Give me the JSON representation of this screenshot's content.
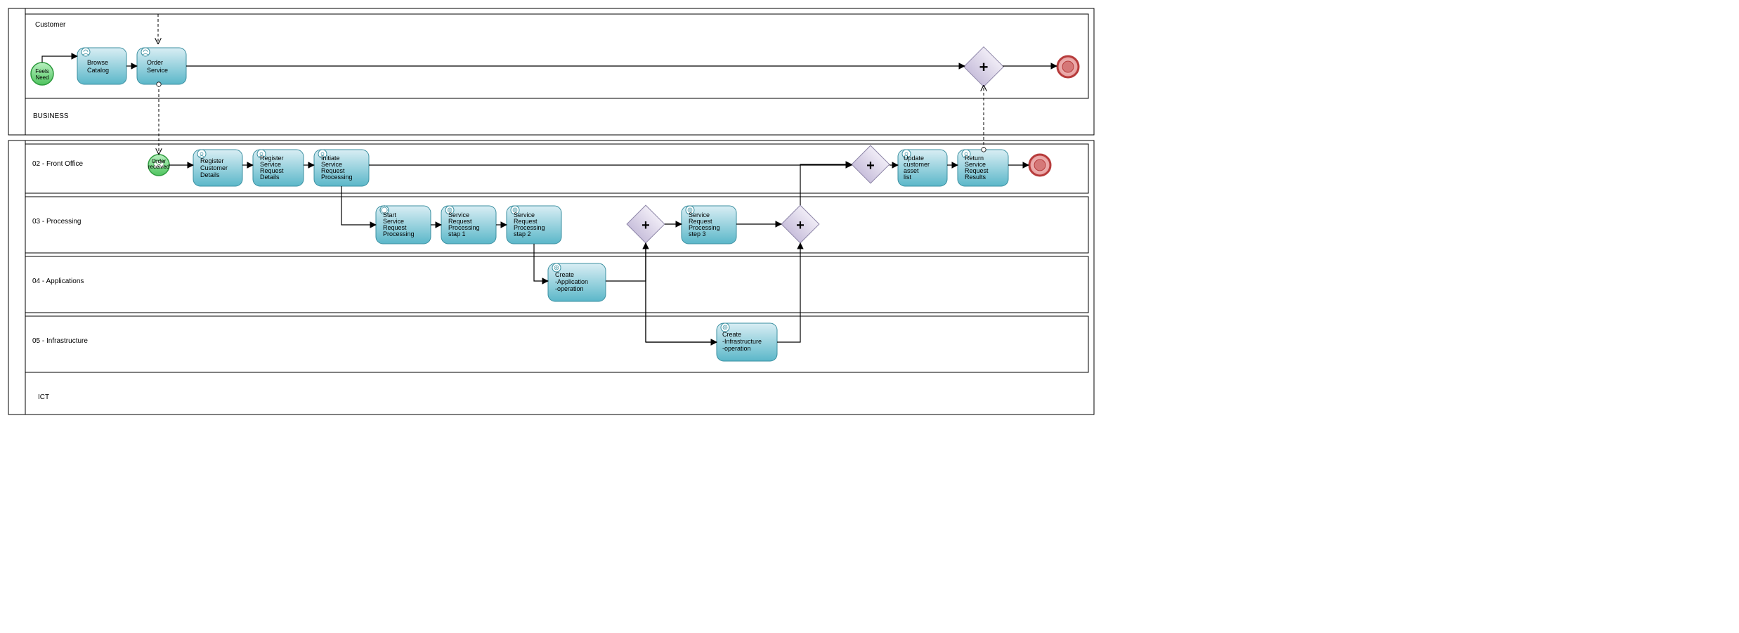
{
  "pools": {
    "business": {
      "label": "BUSINESS"
    },
    "ict": {
      "label": "ICT"
    }
  },
  "lanes": {
    "customer": {
      "label": "Customer"
    },
    "front_office": {
      "label": "02 - Front Office"
    },
    "processing": {
      "label": "03 - Processing"
    },
    "applications": {
      "label": "04 - Applications"
    },
    "infrastructure": {
      "label": "05 - Infrastructure"
    }
  },
  "events": {
    "feels_need": {
      "label": "Feels Need"
    },
    "order_received": {
      "label": "Order received"
    }
  },
  "tasks": {
    "browse_catalog": {
      "label": "Browse Catalog"
    },
    "order_service": {
      "label": "Order Service"
    },
    "register_customer_details": {
      "label": "Register Customer Details"
    },
    "register_service_request_details": {
      "label": "Register Service Request Details"
    },
    "initiate_service_request_processing": {
      "label": "Initiate Service Request Processing"
    },
    "update_customer_asset_list": {
      "label": "Update customer asset list"
    },
    "return_service_request_results": {
      "label": "Return Service Request Results"
    },
    "start_service_request_processing": {
      "label": "Start Service Request Processing"
    },
    "service_request_processing_step1": {
      "label": "Service Request Processing stap 1"
    },
    "service_request_processing_step2": {
      "label": "Service Request Processing stap 2"
    },
    "service_request_processing_step3": {
      "label": "Service Request Processing step 3"
    },
    "create_application_operation": {
      "label": "Create -Application -operation"
    },
    "create_infrastructure_operation": {
      "label": "Create -Infrastructure -operation"
    }
  },
  "colors": {
    "task_fill_top": "#cfeaf2",
    "task_fill_bottom": "#5bb7c9",
    "task_stroke": "#3b8fa0",
    "start_fill": "#7fd88a",
    "start_stroke": "#2e9a3e",
    "end_fill": "#f2bcbc",
    "end_stroke": "#b73c3c",
    "gateway_fill": "#e6e0ee",
    "gateway_stroke": "#8e86a8",
    "lane_stroke": "#000"
  }
}
